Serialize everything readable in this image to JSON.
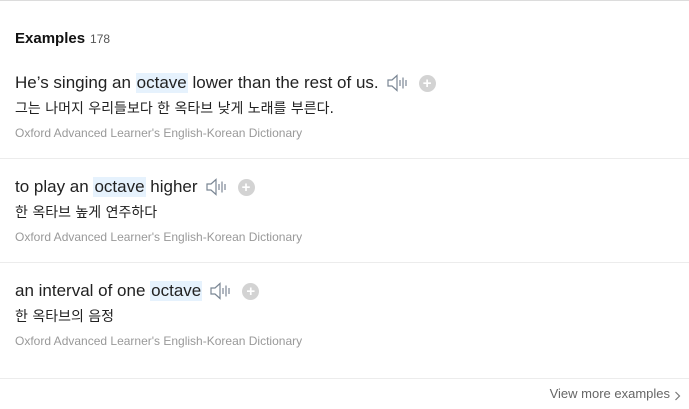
{
  "header": {
    "title": "Examples",
    "count": "178"
  },
  "examples": [
    {
      "before": "He’s singing an ",
      "highlight": "octave",
      "after": " lower than the rest of us.",
      "translation": "그는 나머지 우리들보다 한 옥타브 낮게 노래를 부른다.",
      "source": "Oxford Advanced Learner's English-Korean Dictionary"
    },
    {
      "before": "to play an ",
      "highlight": "octave",
      "after": " higher",
      "translation": "한 옥타브 높게 연주하다",
      "source": "Oxford Advanced Learner's English-Korean Dictionary"
    },
    {
      "before": "an interval of one ",
      "highlight": "octave",
      "after": "",
      "translation": "한 옥타브의 음정",
      "source": "Oxford Advanced Learner's English-Korean Dictionary"
    }
  ],
  "icons": {
    "speaker": "speaker-icon",
    "add": "plus-icon",
    "chevron": "chevron-right-icon"
  },
  "colors": {
    "highlight_bg": "#e6f2fd",
    "source_text": "#999999",
    "plus_bg": "#d3d3d3"
  },
  "footer": {
    "view_more": "View more examples"
  }
}
